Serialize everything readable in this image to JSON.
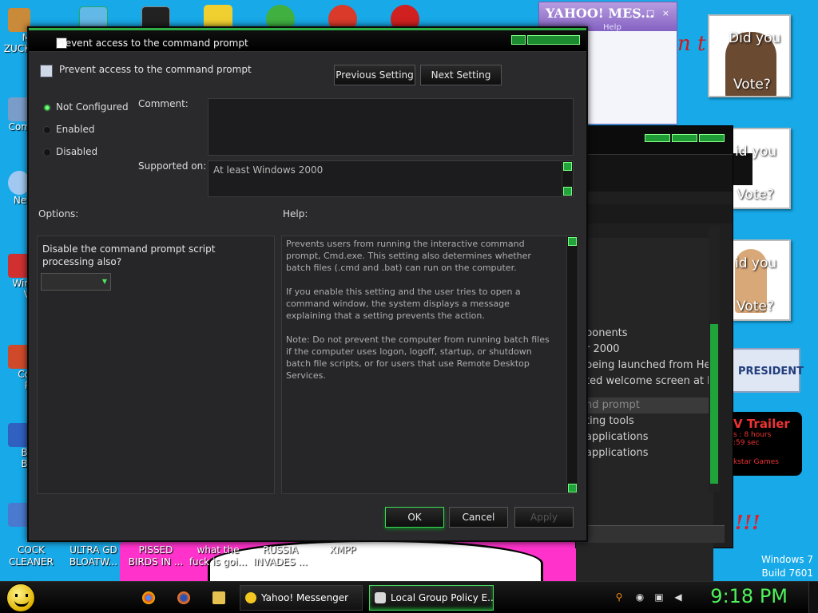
{
  "desktop": {
    "top_icons": [
      {
        "name": "cmd",
        "color": "#222"
      },
      {
        "name": "app1",
        "color": "#62b8e6"
      },
      {
        "name": "app2",
        "color": "#222"
      },
      {
        "name": "app3",
        "color": "#f0d030"
      },
      {
        "name": "app4",
        "color": "#40b040"
      },
      {
        "name": "app5",
        "color": "#d93a2a"
      },
      {
        "name": "dev",
        "color": "#d02020"
      }
    ],
    "left_icons": [
      {
        "label": "M\nZUCK",
        "color": "#c98a3a"
      },
      {
        "label": "Com",
        "color": "#7a9cc8"
      },
      {
        "label": "Net",
        "color": "#a0c8f0"
      },
      {
        "label": "Win\nV",
        "color": "#d03030"
      },
      {
        "label": "Co\nP",
        "color": "#cf4a2a"
      },
      {
        "label": "Bl\nBl",
        "color": "#3060c0"
      }
    ],
    "bottom_icons": [
      {
        "label": "COCK CLEANER"
      },
      {
        "label": "ULTRA GD BLOATW..."
      },
      {
        "label": "PISSED BIRDS IN ..."
      },
      {
        "label": "what the fuck is goi..."
      },
      {
        "label": "RUSSIA INVADES ..."
      },
      {
        "label": "XMPP"
      }
    ],
    "vote_cards": [
      {
        "line1": "Did you",
        "line2": "Vote?"
      },
      {
        "line1": "id you",
        "line2": "Vote?"
      },
      {
        "line1": "id you",
        "line2": "Vote?"
      }
    ],
    "president_card": "PRESIDENT",
    "trailer": {
      "title": "V Trailer",
      "line1": "s : 8 hours",
      "line2": ":59 sec",
      "line3": "kstar Games"
    },
    "red_cursive": "n t",
    "exclaim": "!!!",
    "windows_label": "Windows 7",
    "build_label": "Build 7601"
  },
  "yahoo_window": {
    "logo": "YAHOO! MES...",
    "controls": "_ □ ×",
    "menu": "Help"
  },
  "bg_window": {
    "items": [
      "ponents",
      "r 2000",
      "being launched from Help",
      "ted welcome screen at l...",
      "nd prompt",
      "ting tools",
      "applications",
      "applications"
    ]
  },
  "dialog": {
    "title": "Prevent access to the command prompt",
    "header_title": "Prevent access to the command prompt",
    "prev_label": "Previous Setting",
    "next_label": "Next Setting",
    "radios": [
      {
        "label": "Not Configured",
        "selected": true
      },
      {
        "label": "Enabled",
        "selected": false
      },
      {
        "label": "Disabled",
        "selected": false
      }
    ],
    "comment_label": "Comment:",
    "comment_value": "",
    "supported_label": "Supported on:",
    "supported_value": "At least Windows 2000",
    "options_label": "Options:",
    "help_label": "Help:",
    "option_text": "Disable the command prompt script processing also?",
    "option_selected": "",
    "help_paragraphs": [
      "Prevents users from running the interactive command prompt, Cmd.exe. This setting also determines whether batch files (.cmd and .bat) can run on the computer.",
      "If you enable this setting and the user tries to open a command window, the system displays a message explaining that a setting prevents the action.",
      "Note: Do not prevent the computer from running batch files if the computer uses logon, logoff, startup, or shutdown batch file scripts, or for users that use Remote Desktop Services."
    ],
    "ok_label": "OK",
    "cancel_label": "Cancel",
    "apply_label": "Apply"
  },
  "taskbar": {
    "tasks": [
      {
        "label": "Yahoo! Messenger",
        "active": false
      },
      {
        "label": "Local Group Policy E...",
        "active": true
      }
    ],
    "clock": "9:18 PM"
  },
  "colors": {
    "accent_green": "#3fd857",
    "desktop_blue": "#17a9e8",
    "dialog_bg": "#2a2a2c"
  }
}
